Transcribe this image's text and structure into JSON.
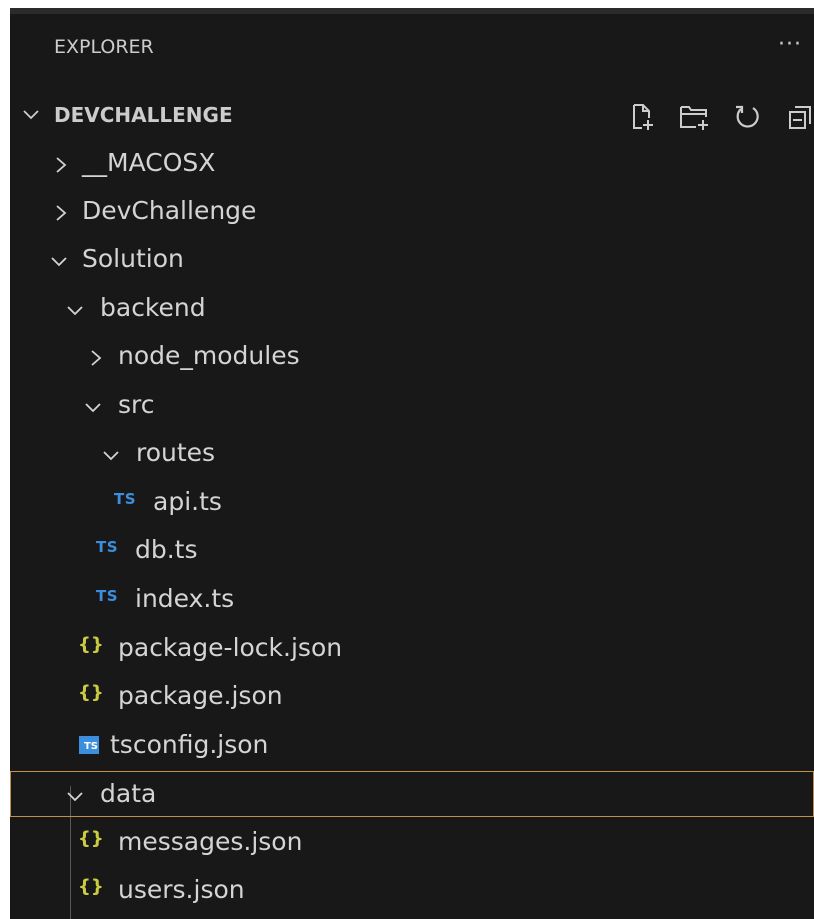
{
  "panel": {
    "header": "EXPLORER",
    "more_label": "···",
    "root": {
      "label": "DEVCHALLENGE",
      "toolbar": [
        "new-file-icon",
        "new-folder-icon",
        "refresh-icon",
        "collapse-all-icon"
      ]
    }
  },
  "tree": {
    "items": [
      {
        "label": "__MACOSX",
        "type": "folder",
        "expanded": false
      },
      {
        "label": "DevChallenge",
        "type": "folder",
        "expanded": false
      },
      {
        "label": "Solution",
        "type": "folder",
        "expanded": true
      },
      {
        "label": "backend",
        "type": "folder",
        "expanded": true
      },
      {
        "label": "node_modules",
        "type": "folder",
        "expanded": false
      },
      {
        "label": "src",
        "type": "folder",
        "expanded": true
      },
      {
        "label": "routes",
        "type": "folder",
        "expanded": true
      },
      {
        "label": "api.ts",
        "type": "ts",
        "icon_text": "TS"
      },
      {
        "label": "db.ts",
        "type": "ts",
        "icon_text": "TS"
      },
      {
        "label": "index.ts",
        "type": "ts",
        "icon_text": "TS"
      },
      {
        "label": "package-lock.json",
        "type": "json",
        "icon_text": "{}"
      },
      {
        "label": "package.json",
        "type": "json",
        "icon_text": "{}"
      },
      {
        "label": "tsconfig.json",
        "type": "tsconfig",
        "icon_text": "TS"
      },
      {
        "label": "data",
        "type": "folder",
        "expanded": true,
        "selected": true
      },
      {
        "label": "messages.json",
        "type": "json",
        "icon_text": "{}"
      },
      {
        "label": "users.json",
        "type": "json",
        "icon_text": "{}"
      }
    ]
  },
  "colors": {
    "background": "#181818",
    "text": "#cccccc",
    "ts_blue": "#3c8fdd",
    "json_yellow": "#cbcb41",
    "focus_border": "#c78d4a"
  }
}
